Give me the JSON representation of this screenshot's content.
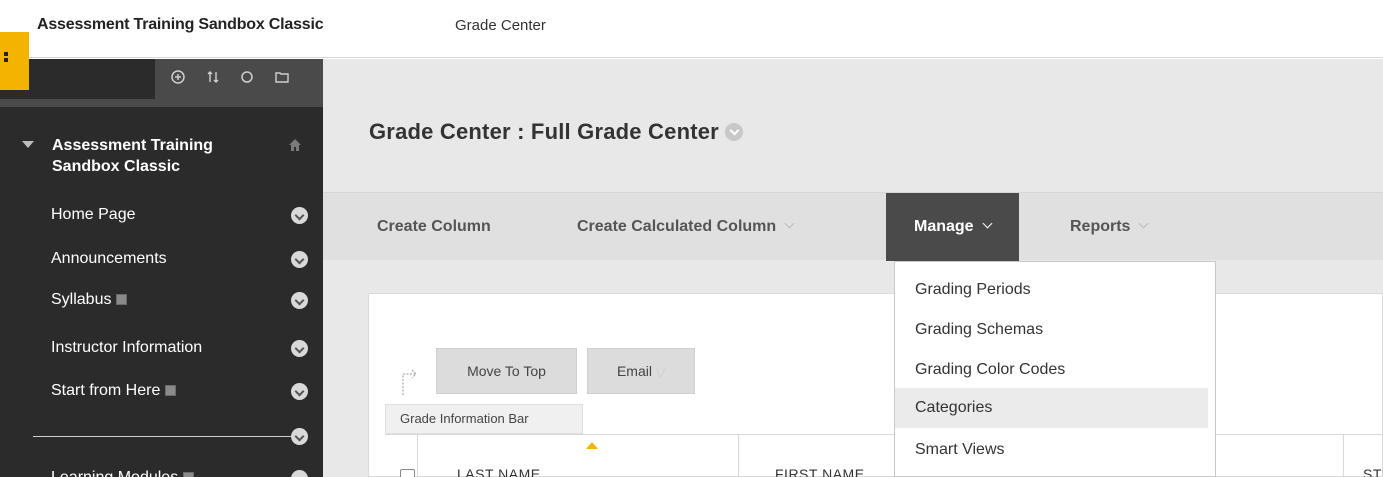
{
  "breadcrumb": {
    "course": "Assessment Training Sandbox Classic",
    "page": "Grade Center"
  },
  "sidebar": {
    "toolbar": [
      "add-icon",
      "reorder-icon",
      "refresh-icon",
      "folder-icon"
    ],
    "course_title": "Assessment Training Sandbox Classic",
    "items": [
      {
        "label": "Home Page"
      },
      {
        "label": "Announcements"
      },
      {
        "label": "Syllabus"
      },
      {
        "label": "Instructor Information"
      },
      {
        "label": "Start from Here"
      },
      {
        "label": "Learning Modules"
      }
    ]
  },
  "main": {
    "title": "Grade Center : Full Grade Center",
    "actions": {
      "create_column": "Create Column",
      "create_calculated": "Create Calculated Column",
      "manage": "Manage",
      "reports": "Reports"
    },
    "panel": {
      "move_to_top": "Move To Top",
      "email": "Email",
      "info_bar": "Grade Information Bar",
      "columns": [
        "LAST NAME",
        "FIRST NAME",
        "STU"
      ]
    }
  },
  "manage_menu": {
    "items": [
      "Grading Periods",
      "Grading Schemas",
      "Grading Color Codes",
      "Categories",
      "Smart Views"
    ],
    "highlighted": "Categories"
  },
  "colors": {
    "accent": "#f3b300",
    "sidebar_bg": "#2b2b2b",
    "manage_bg": "#4a4a4a"
  }
}
